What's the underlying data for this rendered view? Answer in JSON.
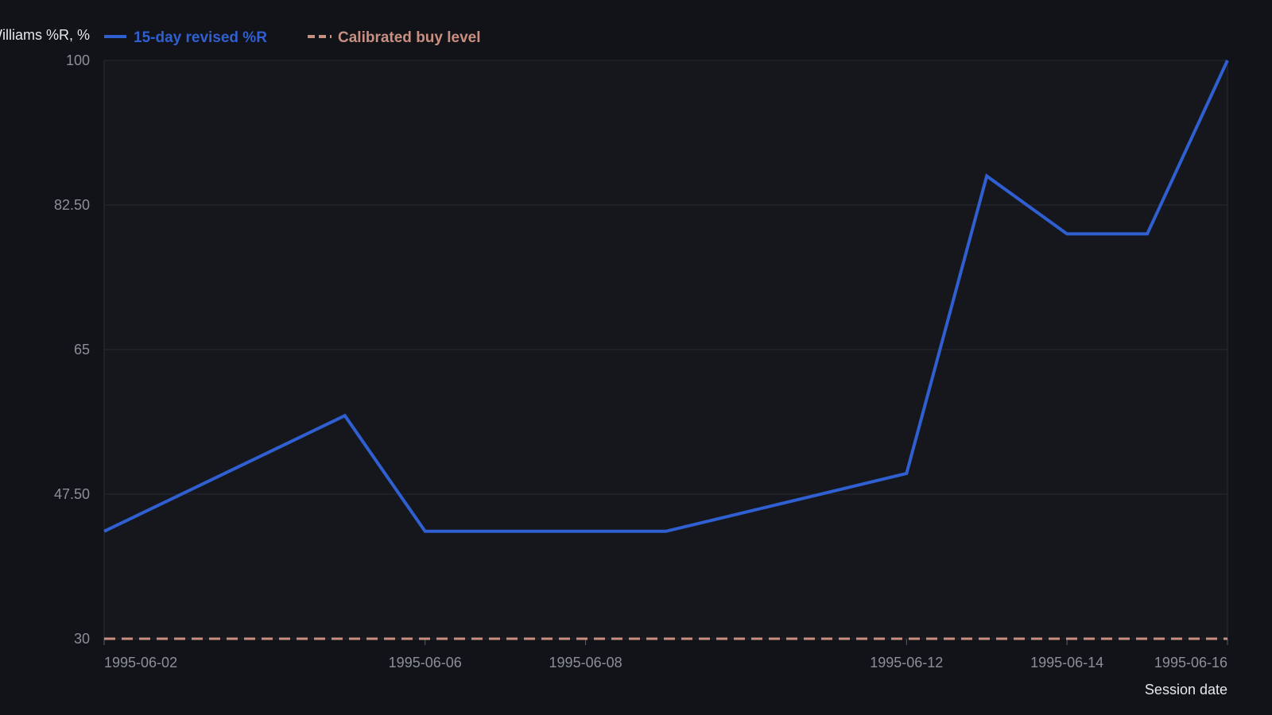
{
  "chart_data": {
    "type": "line",
    "ylabel": "Williams %R, %",
    "xlabel": "Session date",
    "ylim": [
      30,
      100
    ],
    "yticks": [
      "30",
      "47.50",
      "65",
      "82.50",
      "100"
    ],
    "xticks": [
      "1995-06-02",
      "1995-06-06",
      "1995-06-08",
      "1995-06-12",
      "1995-06-14",
      "1995-06-16"
    ],
    "grid": true,
    "legend_position": "top-left",
    "series": [
      {
        "name": "15-day revised %R",
        "color": "#2f5fd0",
        "style": "solid",
        "x": [
          "1995-06-02",
          "1995-06-05",
          "1995-06-06",
          "1995-06-07",
          "1995-06-08",
          "1995-06-09",
          "1995-06-12",
          "1995-06-13",
          "1995-06-14",
          "1995-06-15",
          "1995-06-16"
        ],
        "y": [
          43.0,
          57.0,
          43.0,
          43.0,
          43.0,
          43.0,
          50.0,
          86.0,
          79.0,
          79.0,
          100.0
        ]
      },
      {
        "name": "Calibrated buy level",
        "color": "#c98f80",
        "style": "dashed",
        "x": [
          "1995-06-02",
          "1995-06-16"
        ],
        "y": [
          30,
          30
        ]
      }
    ]
  }
}
